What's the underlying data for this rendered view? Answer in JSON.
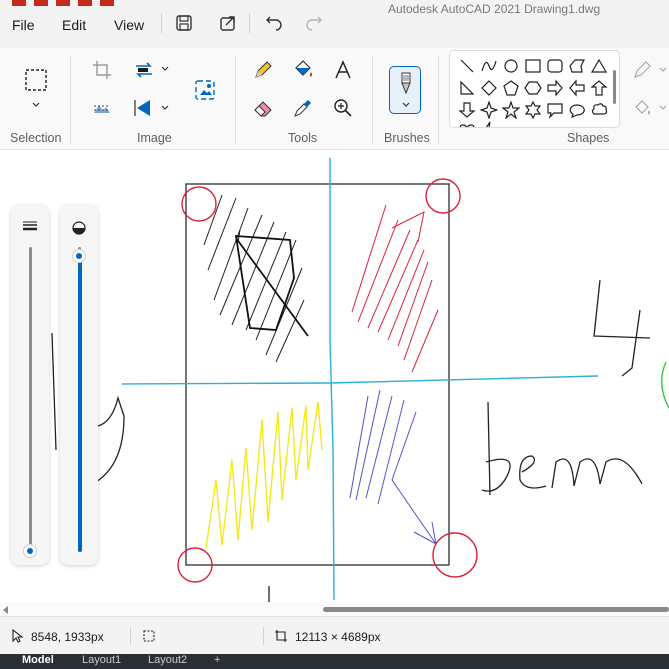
{
  "menu": {
    "file": "File",
    "edit": "Edit",
    "view": "View"
  },
  "background_window": {
    "title": "Autodesk AutoCAD 2021   Drawing1.dwg",
    "tabs": [
      "Model",
      "Layout1",
      "Layout2",
      "+"
    ]
  },
  "ribbon": {
    "groups": {
      "selection": "Selection",
      "image": "Image",
      "tools": "Tools",
      "brushes": "Brushes",
      "shapes": "Shapes"
    }
  },
  "canvas": {
    "handwriting": {
      "digit": "4",
      "word": "Bem"
    }
  },
  "sliders": {
    "size_level": 0.0,
    "opacity_level": 1.0
  },
  "status": {
    "cursor_position": "8548, 1933px",
    "selection_size": "",
    "canvas_size": "12113 × 4689px"
  },
  "icons": {
    "quick_access": [
      "save-icon",
      "share-icon",
      "undo-icon",
      "redo-icon"
    ],
    "tools": [
      "pencil-icon",
      "fill-icon",
      "text-icon",
      "eraser-icon",
      "color-picker-icon",
      "magnifier-icon"
    ]
  },
  "colors": {
    "accent": "#0067c0",
    "canvas_guides": "#2bb0d6"
  }
}
